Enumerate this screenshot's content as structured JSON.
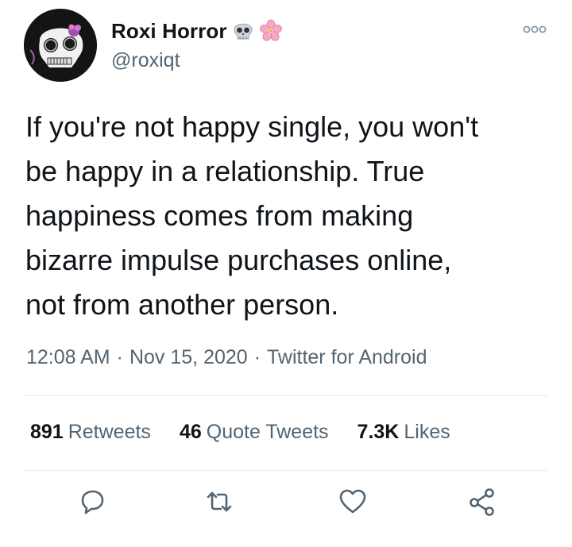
{
  "user": {
    "display_name": "Roxi Horror",
    "name_emojis": [
      "skull-emoji",
      "cherry-blossom-emoji"
    ],
    "handle": "@roxiqt"
  },
  "tweet": {
    "text": "If you're not happy single, you won't\nbe happy in a relationship. True\nhappiness comes from making\nbizarre impulse purchases online,\nnot from another person.",
    "time": "12:08 AM",
    "date": "Nov 15, 2020",
    "source": "Twitter for Android",
    "separator": "·"
  },
  "stats": {
    "retweets_count": "891",
    "retweets_label": "Retweets",
    "quotes_count": "46",
    "quotes_label": "Quote Tweets",
    "likes_count": "7.3K",
    "likes_label": "Likes"
  },
  "actions": [
    "reply-icon",
    "retweet-icon",
    "like-icon",
    "share-icon"
  ],
  "colors": {
    "text": "#0f1419",
    "secondary": "#536471",
    "divider": "#e6ecf0",
    "background": "#ffffff"
  }
}
